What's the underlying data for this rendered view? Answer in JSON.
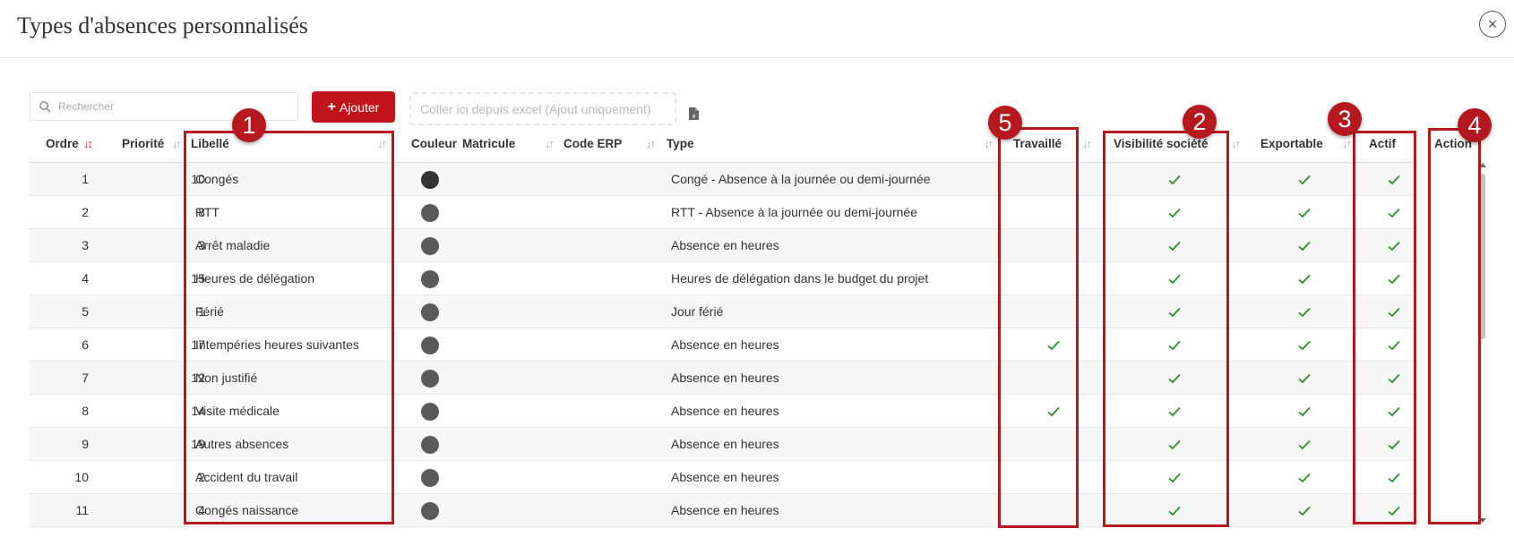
{
  "header": {
    "title": "Types d'absences personnalisés",
    "close_glyph": "×"
  },
  "toolbar": {
    "search_placeholder": "Rechercher",
    "add_label": "Ajouter",
    "add_glyph": "+",
    "paste_placeholder": "Coller ici depuis excel (Ajout uniquement)"
  },
  "columns": {
    "ordre": "Ordre",
    "priorite": "Priorité",
    "libelle": "Libellé",
    "couleur": "Couleur",
    "matricule": "Matricule",
    "code_erp": "Code ERP",
    "type": "Type",
    "travaille": "Travaillé",
    "visibilite": "Visibilité société",
    "exportable": "Exportable",
    "actif": "Actif",
    "action": "Action"
  },
  "rows": [
    {
      "ordre": "1",
      "priorite": "10",
      "libelle": "Congés",
      "couleur": "#333333",
      "type": "Congé - Absence à la journée ou demi-journée",
      "travaille": false,
      "visibilite": true,
      "exportable": true,
      "actif": true
    },
    {
      "ordre": "2",
      "priorite": "8",
      "libelle": "RTT",
      "couleur": "#5a5a5a",
      "type": "RTT - Absence à la journée ou demi-journée",
      "travaille": false,
      "visibilite": true,
      "exportable": true,
      "actif": true
    },
    {
      "ordre": "3",
      "priorite": "3",
      "libelle": "Arrêt maladie",
      "couleur": "#5a5a5a",
      "type": "Absence en heures",
      "travaille": false,
      "visibilite": true,
      "exportable": true,
      "actif": true
    },
    {
      "ordre": "4",
      "priorite": "15",
      "libelle": "Heures de délégation",
      "couleur": "#5a5a5a",
      "type": "Heures de délégation dans le budget du projet",
      "travaille": false,
      "visibilite": true,
      "exportable": true,
      "actif": true
    },
    {
      "ordre": "5",
      "priorite": "1",
      "libelle": "Férié",
      "couleur": "#5a5a5a",
      "type": "Jour férié",
      "travaille": false,
      "visibilite": true,
      "exportable": true,
      "actif": true
    },
    {
      "ordre": "6",
      "priorite": "17",
      "libelle": "Intempéries heures suivantes",
      "couleur": "#5a5a5a",
      "type": "Absence en heures",
      "travaille": true,
      "visibilite": true,
      "exportable": true,
      "actif": true
    },
    {
      "ordre": "7",
      "priorite": "12",
      "libelle": "Non justifié",
      "couleur": "#5a5a5a",
      "type": "Absence en heures",
      "travaille": false,
      "visibilite": true,
      "exportable": true,
      "actif": true
    },
    {
      "ordre": "8",
      "priorite": "14",
      "libelle": "Visite médicale",
      "couleur": "#5a5a5a",
      "type": "Absence en heures",
      "travaille": true,
      "visibilite": true,
      "exportable": true,
      "actif": true
    },
    {
      "ordre": "9",
      "priorite": "19",
      "libelle": "Autres absences",
      "couleur": "#5a5a5a",
      "type": "Absence en heures",
      "travaille": false,
      "visibilite": true,
      "exportable": true,
      "actif": true
    },
    {
      "ordre": "10",
      "priorite": "2",
      "libelle": "Accident du travail",
      "couleur": "#5a5a5a",
      "type": "Absence en heures",
      "travaille": false,
      "visibilite": true,
      "exportable": true,
      "actif": true
    },
    {
      "ordre": "11",
      "priorite": "4",
      "libelle": "Congés naissance",
      "couleur": "#5a5a5a",
      "type": "Absence en heures",
      "travaille": false,
      "visibilite": true,
      "exportable": true,
      "actif": true
    }
  ],
  "annotations": [
    {
      "number": "1",
      "target": "libelle"
    },
    {
      "number": "2",
      "target": "visibilite"
    },
    {
      "number": "3",
      "target": "actif"
    },
    {
      "number": "4",
      "target": "action"
    },
    {
      "number": "5",
      "target": "travaille"
    }
  ],
  "colors": {
    "accent": "#c0141a",
    "annotation": "#b5181e",
    "check": "#2e8b2e"
  },
  "icons": {
    "search": "search-icon",
    "close": "close-icon",
    "excel": "excel-file-icon",
    "sort": "sort-icon",
    "check": "check-icon",
    "edit": "pencil-icon"
  }
}
